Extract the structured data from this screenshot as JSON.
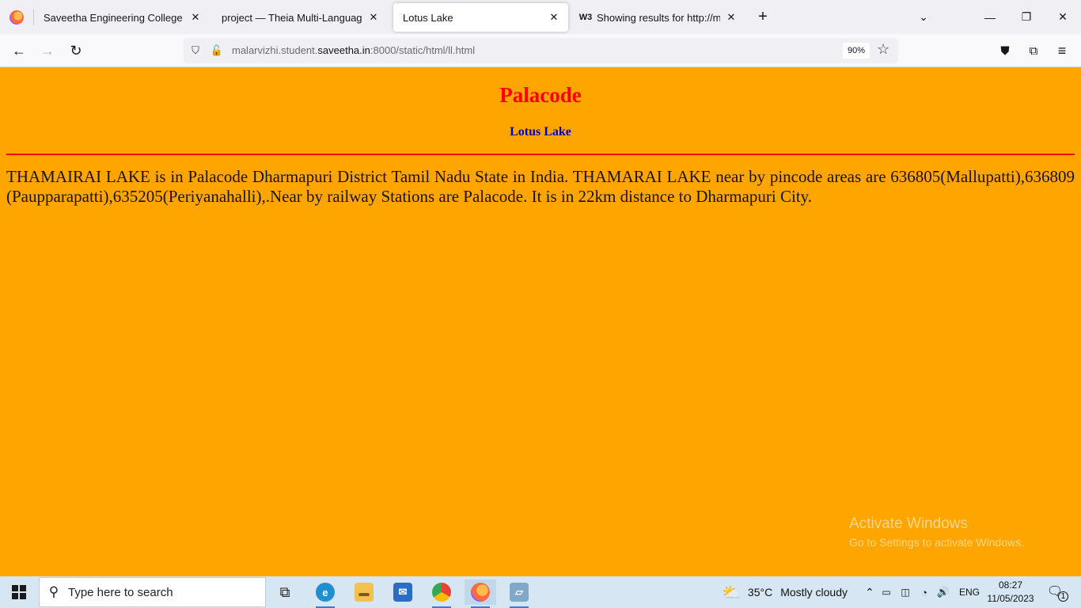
{
  "browser": {
    "tabs": [
      {
        "title": "Saveetha Engineering College",
        "active": false
      },
      {
        "title": "project — Theia Multi-Language Ex",
        "active": false
      },
      {
        "title": "Lotus Lake",
        "active": true
      },
      {
        "title": "Showing results for http://malar",
        "active": false
      }
    ],
    "url_prefix": "malarvizhi.student.",
    "url_domain": "saveetha.in",
    "url_suffix": ":8000/static/html/ll.html",
    "zoom": "90%"
  },
  "page": {
    "heading": "Palacode",
    "subheading": "Lotus Lake",
    "paragraph": "THAMAIRAI LAKE is in Palacode Dharmapuri District Tamil Nadu State in India. THAMARAI LAKE near by pincode areas are 636805(Mallupatti),636809 (Paupparapatti),635205(Periyanahalli),.Near by railway Stations are Palacode. It is in 22km distance to Dharmapuri City.",
    "colors": {
      "background": "#ffa500",
      "heading": "#ff0000",
      "subheading": "#0000cd",
      "rule": "#ff0000"
    }
  },
  "watermark": {
    "line1": "Activate Windows",
    "line2": "Go to Settings to activate Windows."
  },
  "taskbar": {
    "search_placeholder": "Type here to search",
    "weather_temp": "35°C",
    "weather_desc": "Mostly cloudy",
    "language": "ENG",
    "time": "08:27",
    "date": "11/05/2023",
    "notification_count": "1"
  }
}
